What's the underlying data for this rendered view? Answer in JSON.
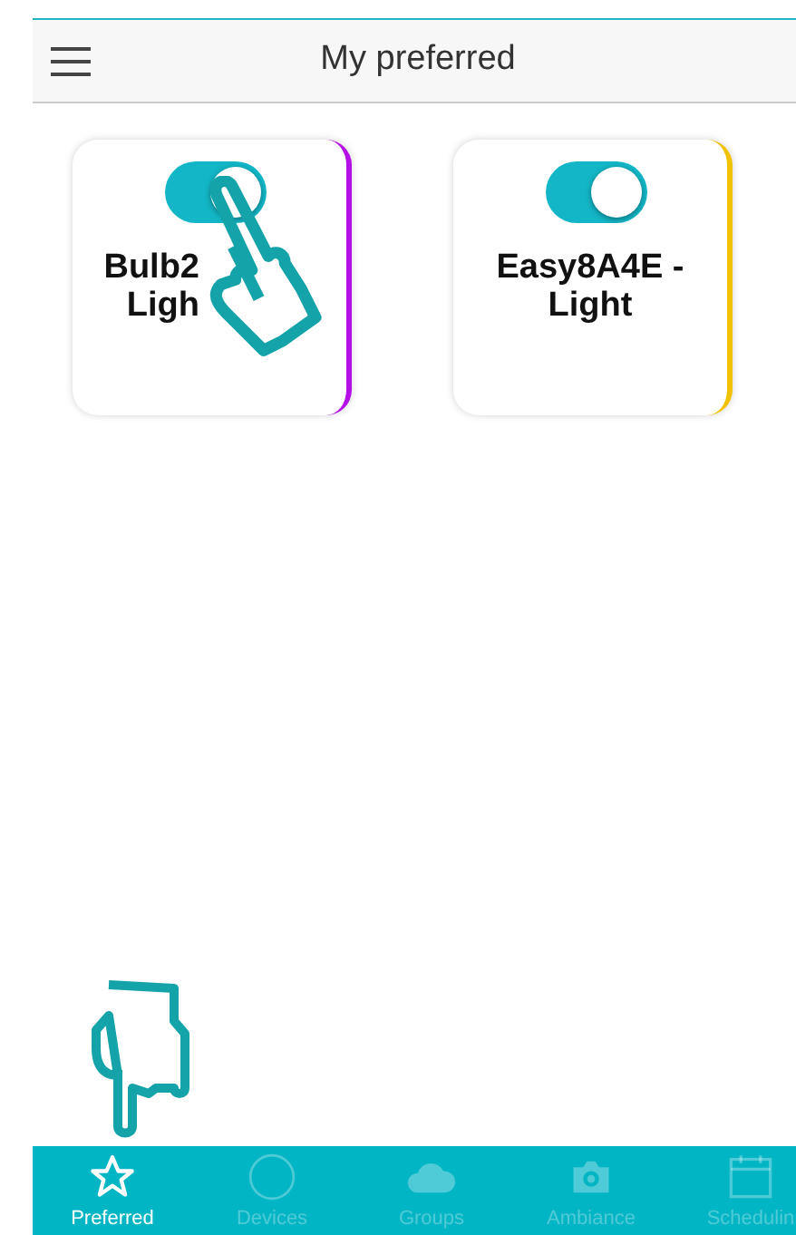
{
  "header": {
    "title": "My preferred"
  },
  "cards": [
    {
      "lines": [
        "Bulb2",
        "Ligh"
      ],
      "on": true,
      "color": "#b30fe6",
      "hand": true
    },
    {
      "lines": [
        "Easy8A4E -",
        "Light"
      ],
      "on": true,
      "color": "#f2c200",
      "hand": false
    }
  ],
  "tabs": [
    {
      "label": "Preferred",
      "kind": "star",
      "selected": true
    },
    {
      "label": "Devices",
      "kind": "circle",
      "selected": false
    },
    {
      "label": "Groups",
      "kind": "cloud",
      "selected": false
    },
    {
      "label": "Ambiance",
      "kind": "camera",
      "selected": false
    },
    {
      "label": "Schedulin",
      "kind": "calendar",
      "selected": false
    }
  ]
}
